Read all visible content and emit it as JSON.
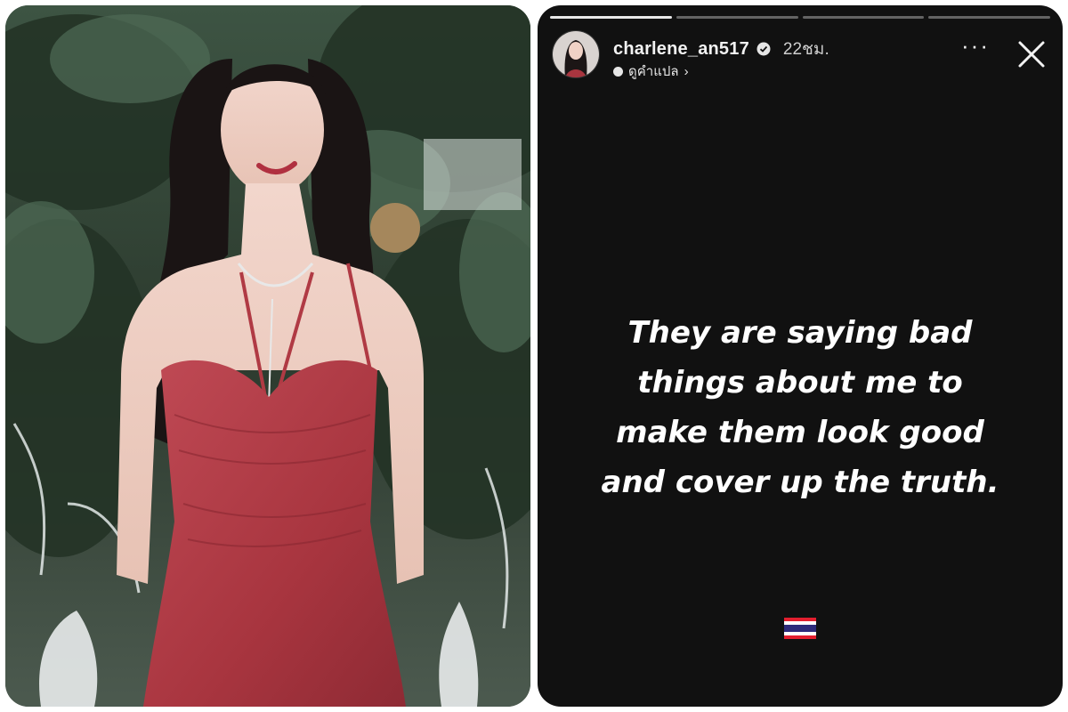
{
  "photo": {
    "subject": "woman-in-red-dress"
  },
  "story": {
    "username": "charlene_an517",
    "time": "22ชม.",
    "translate_link": "ดูคำแปล",
    "chevron": "›",
    "more_label": "···",
    "progress_segments": 4,
    "text_lines": [
      "They are saying bad",
      "things about me to",
      "make them look good",
      "and cover up the truth."
    ],
    "flag": "thailand-flag",
    "icons": {
      "verified": "verified-badge-icon",
      "close": "close-icon",
      "translate": "translate-icon"
    },
    "colors": {
      "background": "#111111",
      "text": "#ffffff",
      "dress": "#b5404a"
    }
  }
}
